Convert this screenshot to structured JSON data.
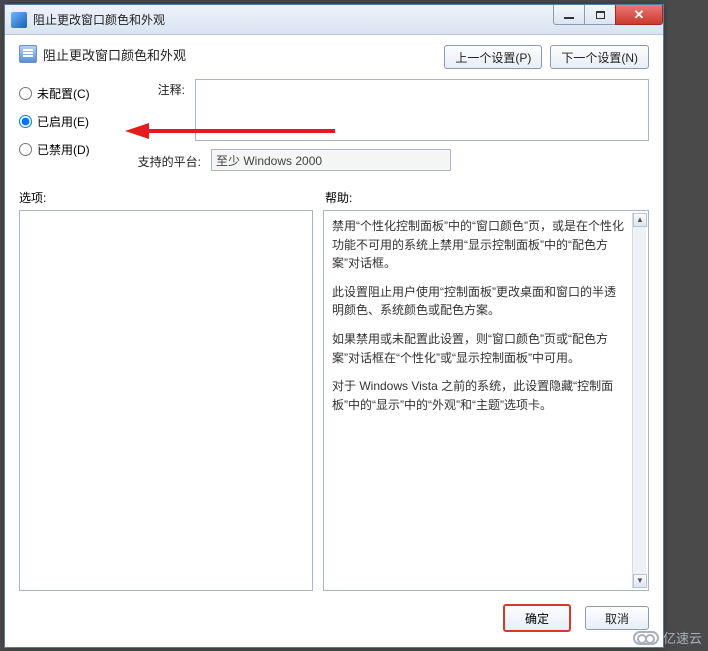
{
  "titlebar": {
    "title": "阻止更改窗口颜色和外观"
  },
  "header": {
    "title": "阻止更改窗口颜色和外观",
    "prev_btn": "上一个设置(P)",
    "next_btn": "下一个设置(N)"
  },
  "radios": {
    "not_configured": "未配置(C)",
    "enabled": "已启用(E)",
    "disabled": "已禁用(D)"
  },
  "fields": {
    "comment_label": "注释:",
    "comment_value": "",
    "supported_label": "支持的平台:",
    "supported_value": "至少 Windows 2000"
  },
  "labels": {
    "options": "选项:",
    "help": "帮助:"
  },
  "help_text": {
    "p1": "禁用“个性化控制面板”中的“窗口颜色”页，或是在个性化功能不可用的系统上禁用“显示控制面板”中的“配色方案”对话框。",
    "p2": "此设置阻止用户使用“控制面板”更改桌面和窗口的半透明颜色、系统颜色或配色方案。",
    "p3": "如果禁用或未配置此设置，则“窗口颜色”页或“配色方案”对话框在“个性化”或“显示控制面板”中可用。",
    "p4": "对于 Windows Vista 之前的系统，此设置隐藏“控制面板”中的“显示”中的“外观”和“主题”选项卡。"
  },
  "footer": {
    "ok": "确定",
    "cancel": "取消"
  },
  "watermark": "亿速云"
}
